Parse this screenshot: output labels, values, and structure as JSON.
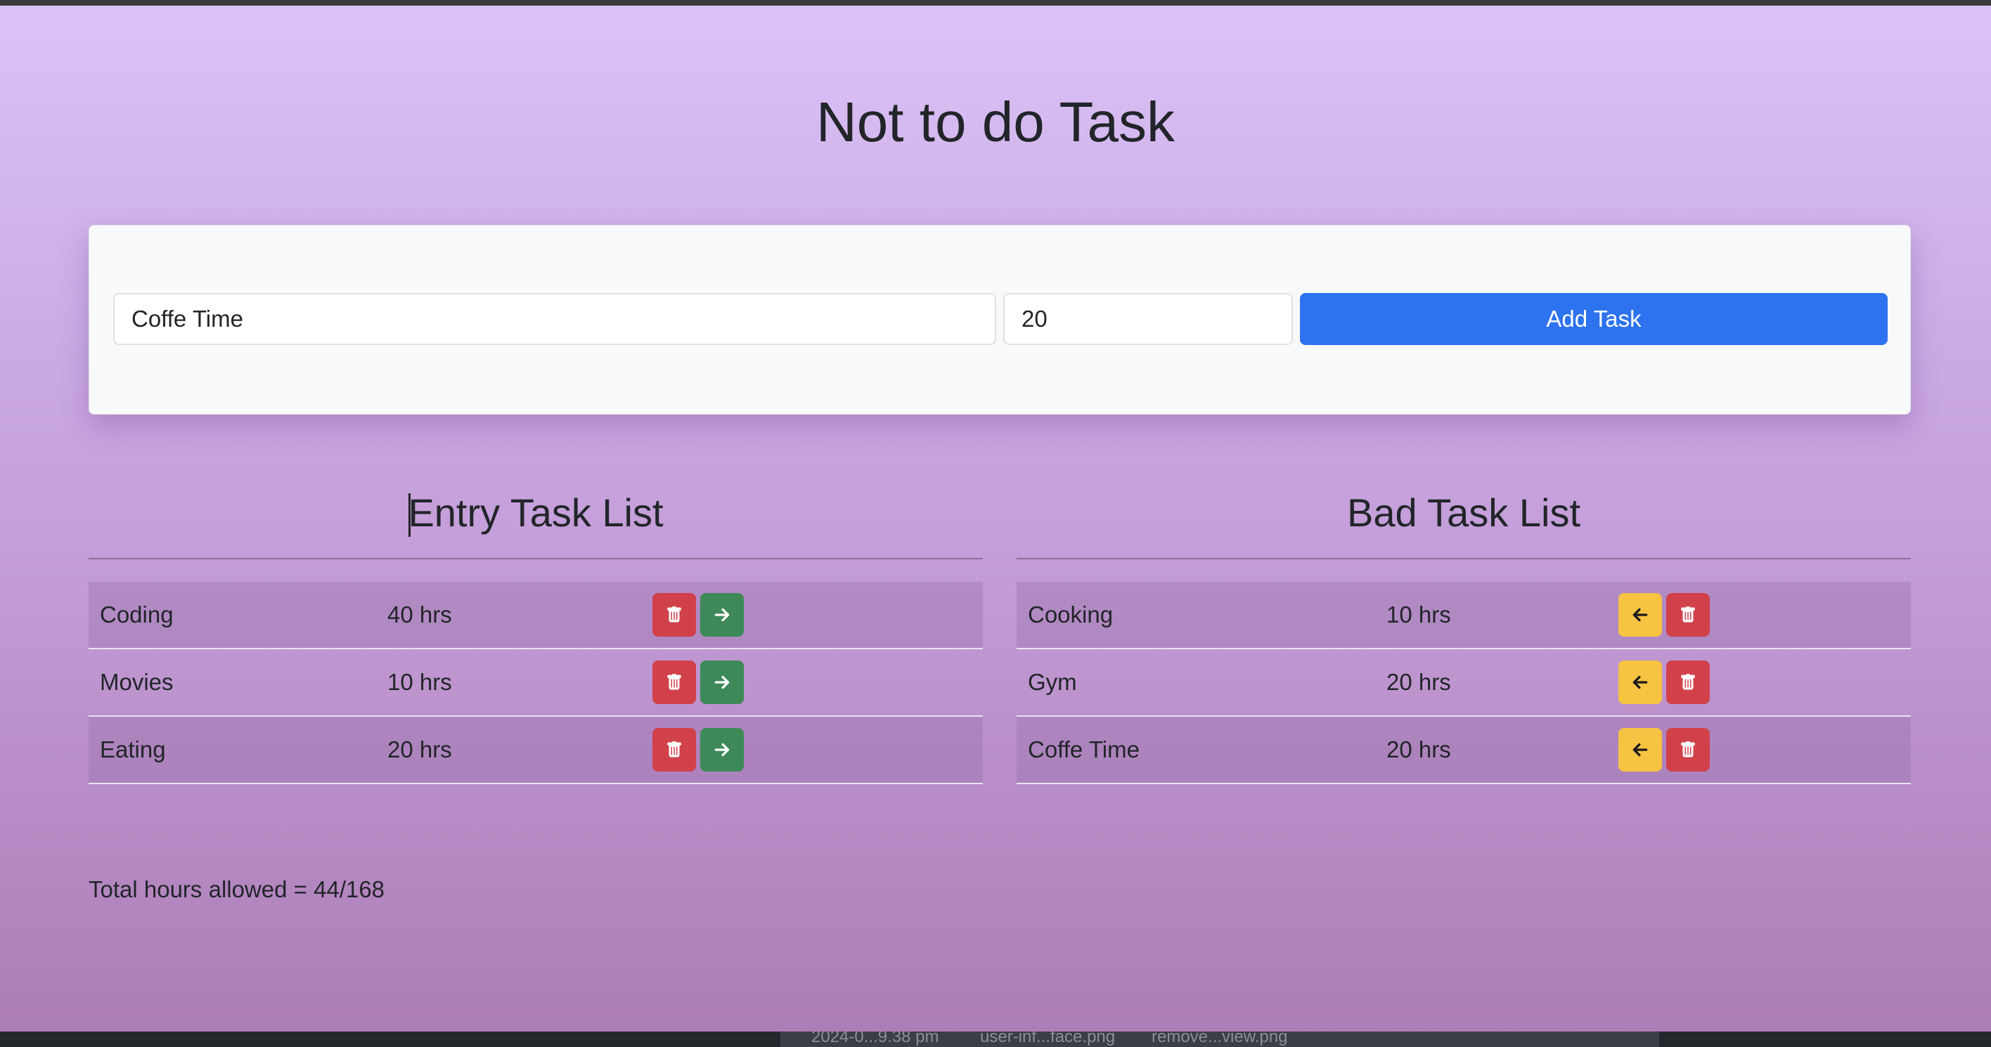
{
  "app": {
    "title": "Not to do Task"
  },
  "form": {
    "task_value": "Coffe Time",
    "hours_value": "20",
    "add_button_label": "Add Task"
  },
  "entry_list": {
    "heading": "Entry Task List",
    "rows": [
      {
        "name": "Coding",
        "hours": "40 hrs"
      },
      {
        "name": "Movies",
        "hours": "10 hrs"
      },
      {
        "name": "Eating",
        "hours": "20 hrs"
      }
    ]
  },
  "bad_list": {
    "heading": "Bad Task List",
    "rows": [
      {
        "name": "Cooking",
        "hours": "10 hrs"
      },
      {
        "name": "Gym",
        "hours": "20 hrs"
      },
      {
        "name": "Coffe Time",
        "hours": "20 hrs"
      }
    ]
  },
  "summary": {
    "total_text": "Total hours allowed = 44/168"
  },
  "dock": {
    "items": [
      "2024-0...9.38 pm",
      "user-inf...face.png",
      "remove...view.png"
    ]
  },
  "icons": {
    "delete": "trash-icon",
    "move_right": "arrow-right-icon",
    "move_left": "arrow-left-icon"
  },
  "colors": {
    "primary": "#2d72ef",
    "danger": "#d1414a",
    "success": "#3d8a58",
    "warning": "#f6c343"
  }
}
